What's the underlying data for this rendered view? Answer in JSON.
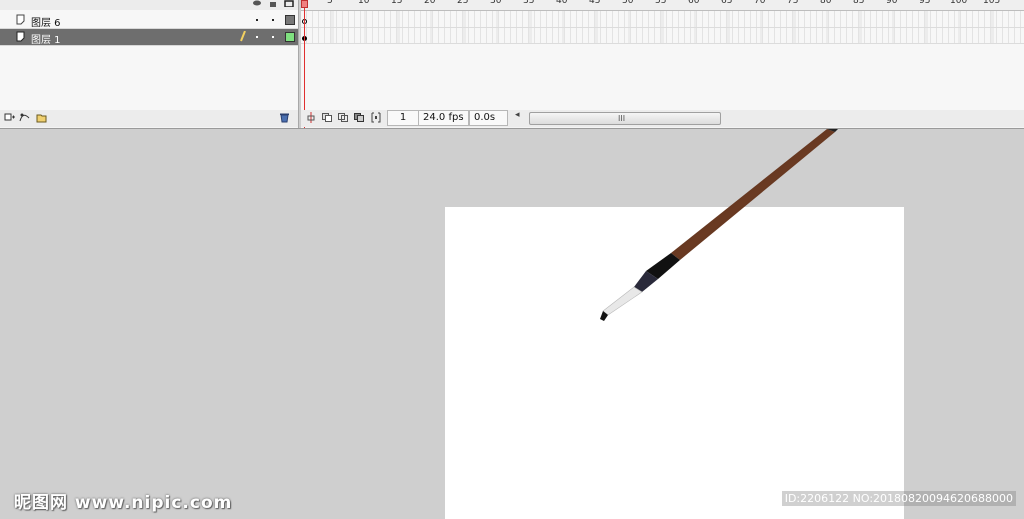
{
  "timeline": {
    "layers": [
      {
        "name": "图层 6",
        "selected": false,
        "color": "#777777",
        "icon": "layer-icon"
      },
      {
        "name": "图层 1",
        "selected": true,
        "color": "#7fe07f",
        "icon": "layer-icon",
        "editing": true
      }
    ],
    "ruler_labels": [
      "5",
      "10",
      "15",
      "20",
      "25",
      "30",
      "35",
      "40",
      "45",
      "50",
      "55",
      "60",
      "65",
      "70",
      "75",
      "80",
      "85",
      "90",
      "95",
      "100",
      "105"
    ],
    "current_frame": "1",
    "fps": "24.0 fps",
    "elapsed": "0.0s",
    "scroll_grip": "III"
  },
  "watermark": {
    "logo": "昵图网 www.nipic.com",
    "id": "ID:2206122 NO:20180820094620688000"
  },
  "colors": {
    "playhead": "#e03030",
    "stage_bg": "#cfcfcf",
    "canvas": "#ffffff",
    "brush_handle": "#4a2a18"
  }
}
